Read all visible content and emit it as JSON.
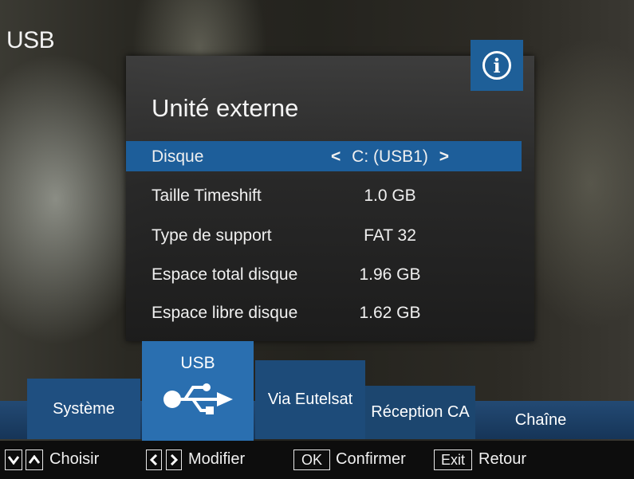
{
  "header": {
    "title": "USB"
  },
  "dialog": {
    "heading": "Unité externe",
    "info_icon": "info-icon",
    "rows": [
      {
        "label": "Disque",
        "value": "C: (USB1)",
        "selected": true
      },
      {
        "label": "Taille Timeshift",
        "value": "1.0 GB"
      },
      {
        "label": "Type de support",
        "value": "FAT 32"
      },
      {
        "label": "Espace total disque",
        "value": "1.96 GB"
      },
      {
        "label": "Espace libre disque",
        "value": "1.62 GB"
      }
    ],
    "arrow_left": "<",
    "arrow_right": ">"
  },
  "tabs": {
    "systeme": "Système",
    "usb": "USB",
    "usb_icon": "usb-icon",
    "eutelsat": "Via Eutelsat",
    "reception": "Réception CA",
    "chaine": "Chaîne"
  },
  "hints": {
    "choisir": "Choisir",
    "modifier": "Modifier",
    "ok_key": "OK",
    "confirmer": "Confirmer",
    "exit_key": "Exit",
    "retour": "Retour"
  },
  "colors": {
    "accent": "#1d5e9a",
    "tab_active": "#2a6fb0",
    "panel": "#2c2c2c"
  }
}
